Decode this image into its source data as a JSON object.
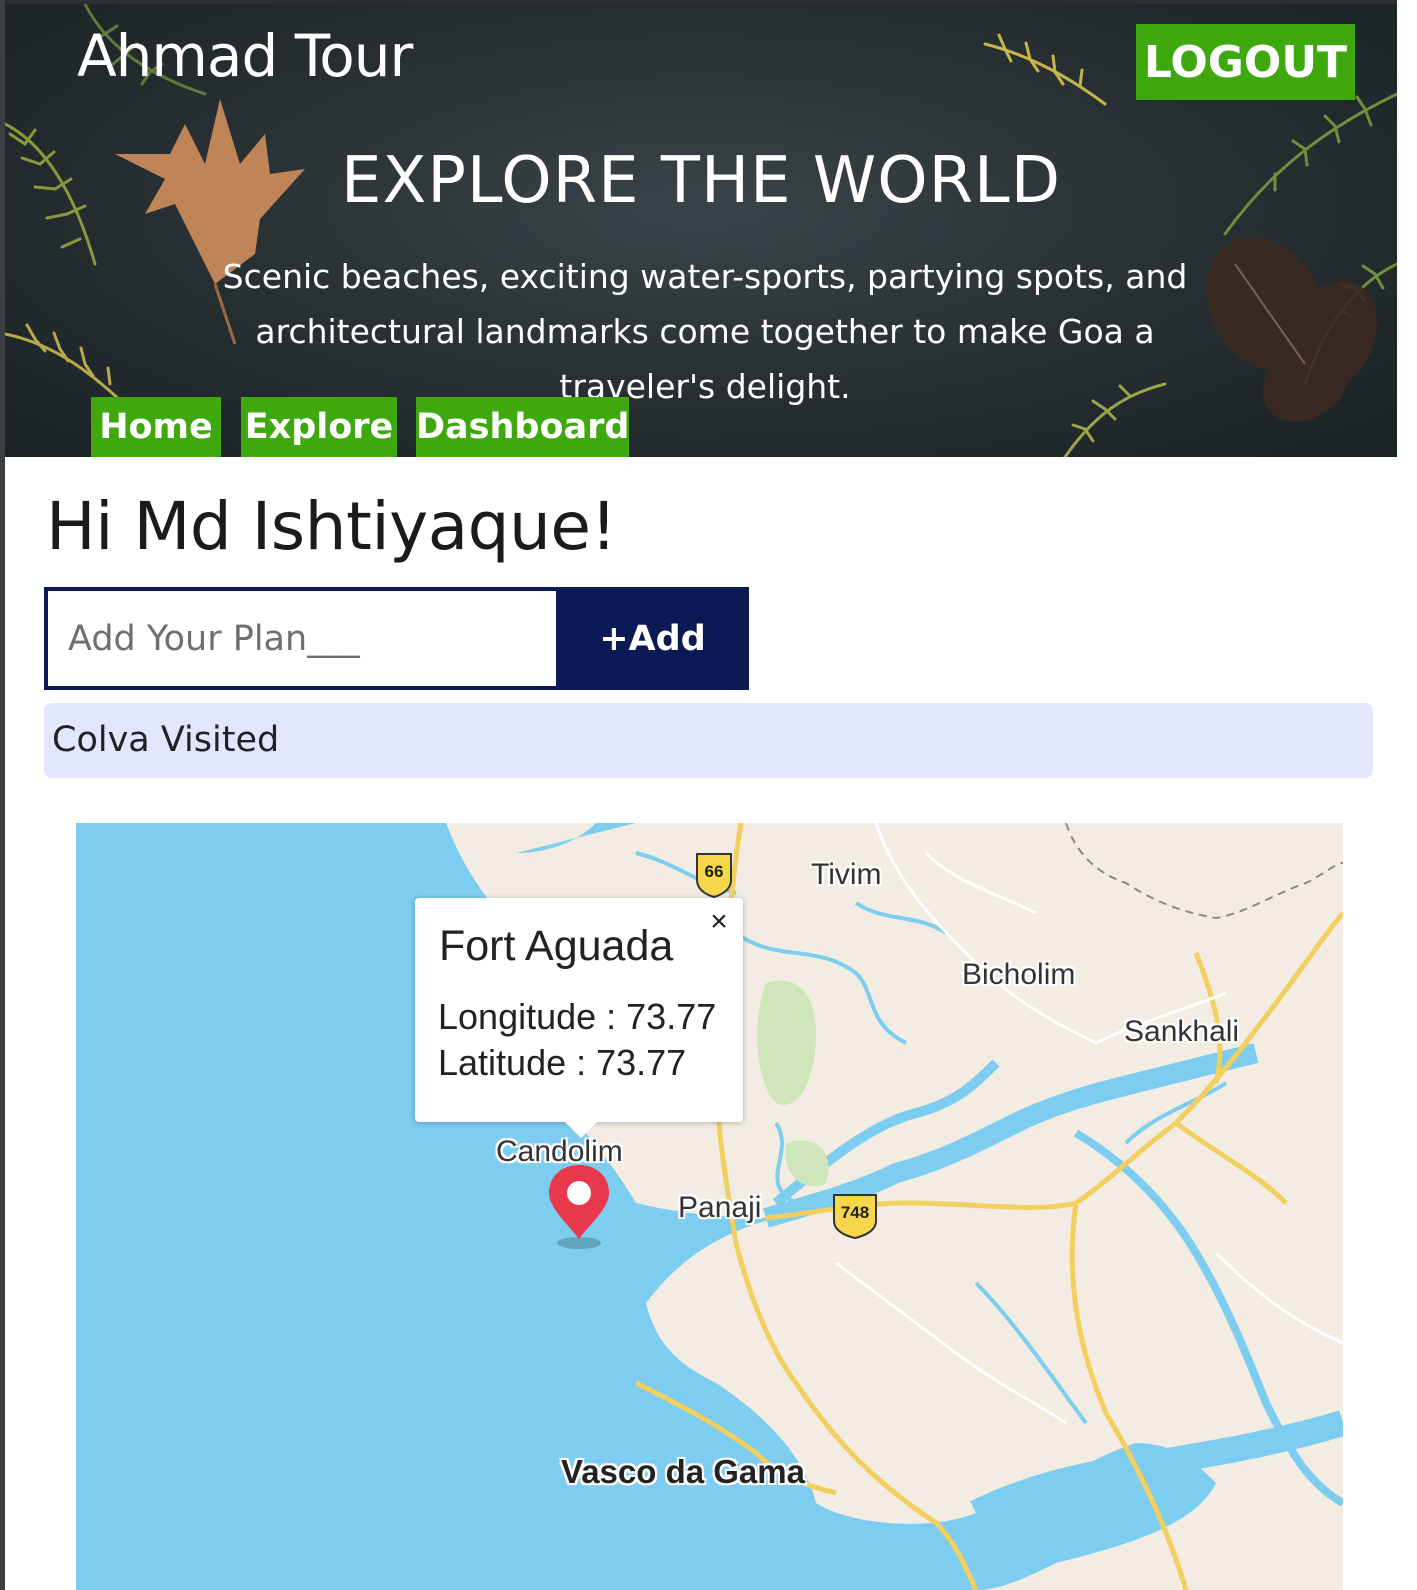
{
  "header": {
    "brand": "Ahmad Tour",
    "logout_label": "LOGOUT",
    "title": "EXPLORE THE WORLD",
    "description": "Scenic beaches, exciting water-sports, partying spots, and architectural landmarks come together to make Goa a traveler's delight.",
    "nav": [
      {
        "label": "Home"
      },
      {
        "label": "Explore"
      },
      {
        "label": "Dashboard"
      }
    ]
  },
  "main": {
    "greeting": "Hi Md Ishtiyaque!",
    "plan_input": {
      "placeholder": "Add Your Plan___",
      "value": ""
    },
    "add_button_label": "+Add",
    "plans": [
      "Colva Visited"
    ]
  },
  "map": {
    "labels": {
      "tivim": "Tivim",
      "bicholim": "Bicholim",
      "sankhali": "Sankhali",
      "candolim": "Candolim",
      "panaji": "Panaji",
      "vasco": "Vasco da Gama"
    },
    "shields": {
      "nh66": "66",
      "nh748": "748"
    },
    "popup": {
      "title": "Fort Aguada",
      "longitude_text": "Longitude : 73.77",
      "latitude_text": "Latitude : 73.77",
      "close_glyph": "×"
    },
    "colors": {
      "water": "#7ccdef",
      "land": "#f2ece3",
      "road": "#f3cf5f",
      "marker": "#e8384b"
    }
  },
  "theme": {
    "accent_green": "#3fa80f",
    "navy": "#0b1a54",
    "plan_bg": "#e2e7ff"
  }
}
